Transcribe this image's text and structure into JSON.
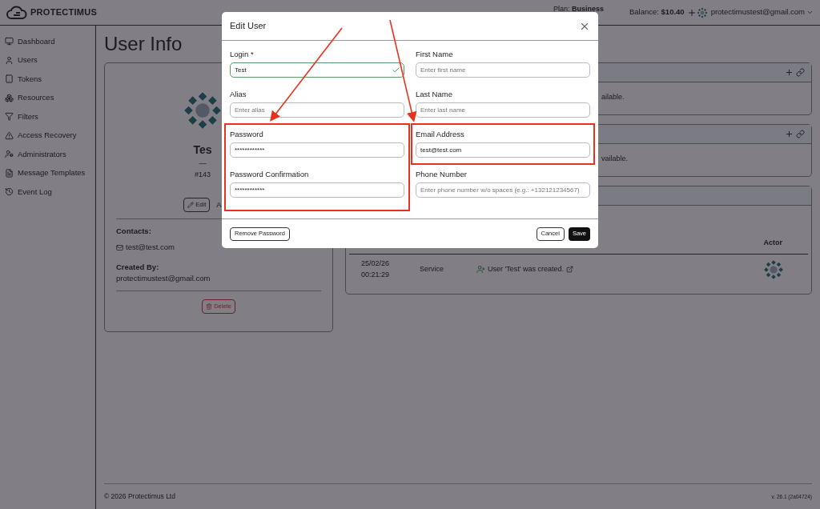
{
  "header": {
    "brand": "PROTECTIMUS",
    "plan_label": "Plan:",
    "plan": "Business",
    "balance_label": "Balance:",
    "balance": "$10.40",
    "account": "protectimustest@gmail.com"
  },
  "sidebar": {
    "items": [
      {
        "label": "Dashboard"
      },
      {
        "label": "Users"
      },
      {
        "label": "Tokens"
      },
      {
        "label": "Resources"
      },
      {
        "label": "Filters"
      },
      {
        "label": "Access Recovery"
      },
      {
        "label": "Administrators"
      },
      {
        "label": "Message Templates"
      },
      {
        "label": "Event Log"
      }
    ]
  },
  "page": {
    "title": "User Info"
  },
  "user_card": {
    "name": "Tes",
    "dash": "—",
    "id": "#143",
    "edit_button": "Edit",
    "next_button": "A",
    "contacts_label": "Contacts:",
    "email": "test@test.com",
    "created_by_label": "Created By:",
    "created_by": "protectimustest@gmail.com",
    "delete_button": "Delete"
  },
  "panels": [
    {
      "note": "ailable."
    },
    {
      "note": "vailable."
    }
  ],
  "events": {
    "columns": [
      "Actor"
    ],
    "rows": [
      {
        "date": "25/02/26",
        "time": "00:21:29",
        "source": "Service",
        "message": "User 'Test' was created."
      }
    ]
  },
  "footer": {
    "copyright": "© 2026 Protectimus Ltd",
    "version": "v. 26.1 (2a04724)"
  },
  "dialog": {
    "title": "Edit User",
    "fields": [
      {
        "label": "Login *",
        "value": "Test",
        "valid": true
      },
      {
        "label": "First Name",
        "placeholder": "Enter first name"
      },
      {
        "label": "Alias",
        "placeholder": "Enter alias"
      },
      {
        "label": "Last Name",
        "placeholder": "Enter last name"
      },
      {
        "label": "Password",
        "value": "************"
      },
      {
        "label": "Email Address",
        "value": "test@test.com"
      },
      {
        "label": "Password Confirmation",
        "value": "************"
      },
      {
        "label": "Phone Number",
        "placeholder": "Enter phone number w/o spaces (e.g.: +132121234567)"
      }
    ],
    "remove_button": "Remove Password",
    "cancel_button": "Cancel",
    "save_button": "Save"
  }
}
